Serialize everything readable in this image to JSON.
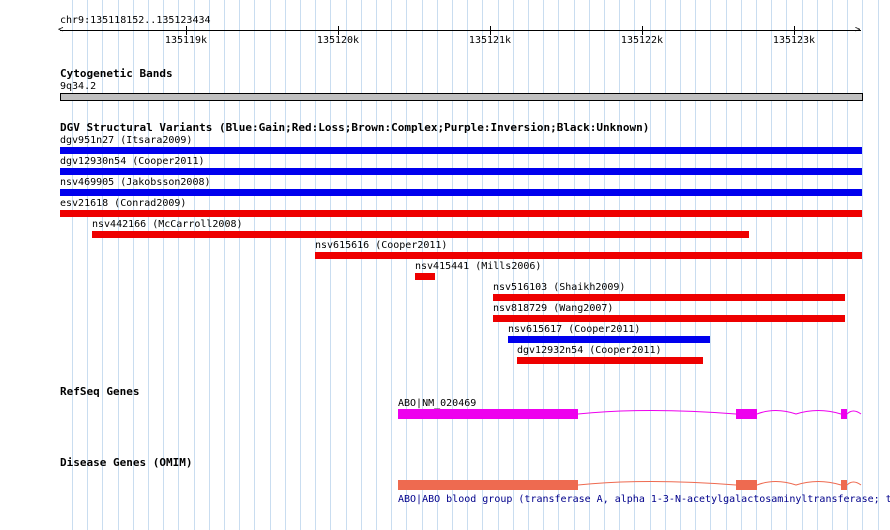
{
  "ruler": {
    "location": "chr9:135118152..135123434",
    "ticks": [
      "135119k",
      "135120k",
      "135121k",
      "135122k",
      "135123k"
    ]
  },
  "cyto": {
    "title": "Cytogenetic Bands",
    "band": "9q34.2"
  },
  "dgv": {
    "title": "DGV Structural Variants (Blue:Gain;Red:Loss;Brown:Complex;Purple:Inversion;Black:Unknown)",
    "colors": {
      "gain": "#0000ee",
      "loss": "#ee0000"
    },
    "variants": [
      {
        "label": "dgv951n27 (Itsara2009)",
        "type": "gain"
      },
      {
        "label": "dgv12930n54 (Cooper2011)",
        "type": "gain"
      },
      {
        "label": "nsv469905 (Jakobsson2008)",
        "type": "gain"
      },
      {
        "label": "esv21618 (Conrad2009)",
        "type": "loss"
      },
      {
        "label": "nsv442166 (McCarroll2008)",
        "type": "loss"
      },
      {
        "label": "nsv615616 (Cooper2011)",
        "type": "loss"
      },
      {
        "label": "nsv415441 (Mills2006)",
        "type": "loss"
      },
      {
        "label": "nsv516103 (Shaikh2009)",
        "type": "loss"
      },
      {
        "label": "nsv818729 (Wang2007)",
        "type": "loss"
      },
      {
        "label": "nsv615617 (Cooper2011)",
        "type": "gain"
      },
      {
        "label": "dgv12932n54 (Cooper2011)",
        "type": "loss"
      }
    ]
  },
  "refseq": {
    "title": "RefSeq Genes",
    "gene_label": "ABO|NM_020469",
    "color": "#ee00ee"
  },
  "omim": {
    "title": "Disease Genes (OMIM)",
    "description": "ABO|ABO blood group (transferase A, alpha 1-3-N-acetylgalactosaminyltransferase; t",
    "color": "#ee6a50"
  }
}
